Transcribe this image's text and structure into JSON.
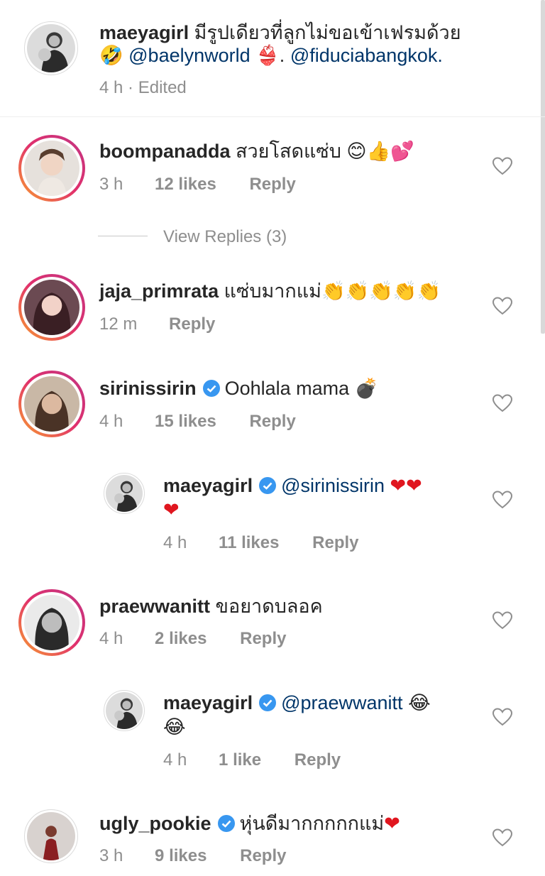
{
  "caption": {
    "username": "maeyagirl",
    "text": "มีรูปเดียวที่ลูกไม่ขอเข้าเฟรมด้วย",
    "line2_emoji": "🤣",
    "mention1": "@baelynworld",
    "emoji_bikini": "👙",
    "sep": ".",
    "mention2": "@fiduciabangkok.",
    "time": "4 h",
    "dot": "·",
    "edited": "Edited"
  },
  "comments": [
    {
      "username": "boompanadda",
      "text": "สวยโสดแซ่บ",
      "emoji": "😊👍💕",
      "time": "3 h",
      "likes": "12 likes",
      "reply": "Reply",
      "view_replies": "View Replies (3)"
    },
    {
      "username": "jaja_primrata",
      "text": "แซ่บมากแม่",
      "emoji": "👏👏👏👏👏",
      "time": "12 m",
      "reply": "Reply"
    },
    {
      "username": "sirinissirin",
      "text": "Oohlala mama",
      "emoji": "💣",
      "time": "4 h",
      "likes": "15 likes",
      "reply": "Reply"
    },
    {
      "username": "maeyagirl",
      "mention": "@sirinissirin",
      "emoji": "❤❤",
      "emoji2": "❤",
      "time": "4 h",
      "likes": "11 likes",
      "reply": "Reply"
    },
    {
      "username": "praewwanitt",
      "text": "ขอยาดบลอค",
      "time": "4 h",
      "likes": "2 likes",
      "reply": "Reply"
    },
    {
      "username": "maeyagirl",
      "mention": "@praewwanitt",
      "emoji": "😂",
      "emoji2": "😂",
      "time": "4 h",
      "likes": "1 like",
      "reply": "Reply"
    },
    {
      "username": "ugly_pookie",
      "text": "หุ่นดีมากกกกกแม่",
      "emoji": "❤",
      "time": "3 h",
      "likes": "9 likes",
      "reply": "Reply"
    }
  ],
  "colors": {
    "text": "#262626",
    "meta": "#8e8e8e",
    "mention": "#003569",
    "verified": "#3897f0",
    "heart_red": "#e0161f"
  }
}
